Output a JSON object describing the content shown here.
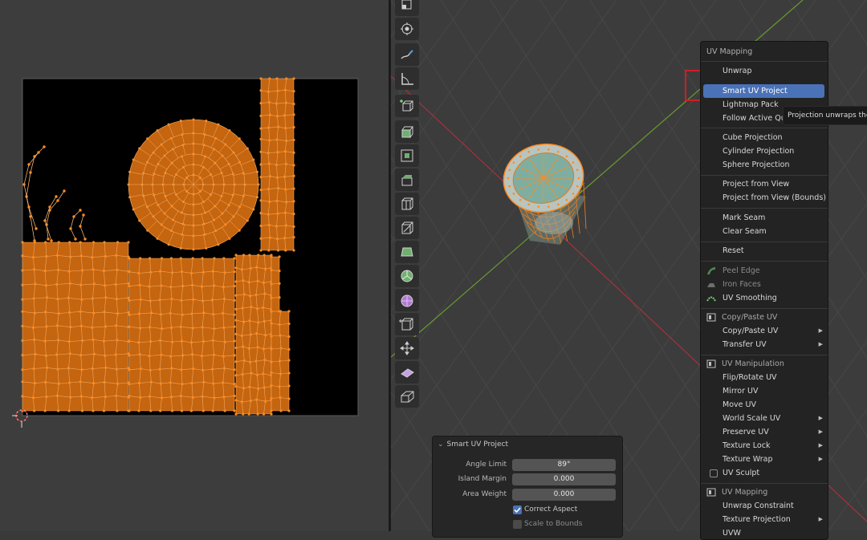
{
  "uv_menu": {
    "title": "UV Mapping",
    "items": [
      {
        "label": "Unwrap",
        "type": "item"
      },
      {
        "label": "Smart UV Project",
        "type": "item",
        "highlighted": true
      },
      {
        "label": "Lightmap Pack",
        "type": "item"
      },
      {
        "label": "Follow Active Quads",
        "type": "item"
      },
      {
        "label": "Cube Projection",
        "type": "item"
      },
      {
        "label": "Cylinder Projection",
        "type": "item"
      },
      {
        "label": "Sphere Projection",
        "type": "item"
      },
      {
        "label": "Project from View",
        "type": "item"
      },
      {
        "label": "Project from View (Bounds)",
        "type": "item"
      },
      {
        "label": "Mark Seam",
        "type": "item"
      },
      {
        "label": "Clear Seam",
        "type": "item"
      },
      {
        "label": "Reset",
        "type": "item"
      },
      {
        "label": "Peel Edge",
        "type": "item",
        "disabled": true,
        "icon": "peel-edge-icon"
      },
      {
        "label": "Iron Faces",
        "type": "item",
        "disabled": true,
        "icon": "iron-faces-icon"
      },
      {
        "label": "UV Smoothing",
        "type": "item",
        "icon": "uv-smoothing-icon"
      },
      {
        "label": "Copy/Paste UV",
        "type": "section",
        "icon": "addon-icon"
      },
      {
        "label": "Copy/Paste UV",
        "type": "submenu"
      },
      {
        "label": "Transfer UV",
        "type": "submenu"
      },
      {
        "label": "UV Manipulation",
        "type": "section",
        "icon": "addon-icon"
      },
      {
        "label": "Flip/Rotate UV",
        "type": "item"
      },
      {
        "label": "Mirror UV",
        "type": "item"
      },
      {
        "label": "Move UV",
        "type": "item"
      },
      {
        "label": "World Scale UV",
        "type": "submenu"
      },
      {
        "label": "Preserve UV",
        "type": "submenu"
      },
      {
        "label": "Texture Lock",
        "type": "submenu"
      },
      {
        "label": "Texture Wrap",
        "type": "submenu"
      },
      {
        "label": "UV Sculpt",
        "type": "checkbox"
      },
      {
        "label": "UV Mapping",
        "type": "section",
        "icon": "addon-icon"
      },
      {
        "label": "Unwrap Constraint",
        "type": "item"
      },
      {
        "label": "Texture Projection",
        "type": "submenu"
      },
      {
        "label": "UVW",
        "type": "item"
      }
    ],
    "tooltip": "Projection unwraps the selected faces of mesh objects"
  },
  "operator_panel": {
    "title": "Smart UV Project",
    "angle_limit_label": "Angle Limit",
    "angle_limit_value": "89°",
    "island_margin_label": "Island Margin",
    "island_margin_value": "0.000",
    "area_weight_label": "Area Weight",
    "area_weight_value": "0.000",
    "correct_aspect_label": "Correct Aspect",
    "correct_aspect_checked": true,
    "scale_to_bounds_label": "Scale to Bounds",
    "scale_to_bounds_checked": false
  },
  "toolbar": {
    "tools": [
      "scale-cage-icon",
      "transform-icon",
      "annotate-icon",
      "measure-icon",
      "add-cube-icon",
      "extrude-region-icon",
      "inset-faces-icon",
      "bevel-icon",
      "loop-cut-icon",
      "knife-icon",
      "poly-build-icon",
      "spin-icon",
      "smooth-vertices-icon",
      "edge-slide-icon",
      "shrink-fatten-icon",
      "shear-icon",
      "rip-region-icon"
    ]
  },
  "colors": {
    "accent": "#4a72b8",
    "uv_face": "#c5650f",
    "uv_vertex": "#ff8a1f",
    "highlight_box": "#d11d24",
    "axis_x": "#b03040",
    "axis_y": "#6a9a30"
  }
}
